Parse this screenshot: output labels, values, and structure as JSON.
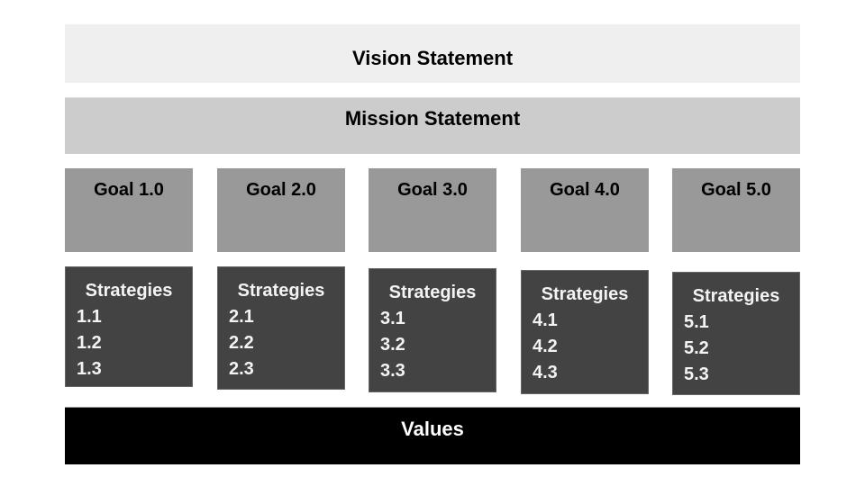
{
  "vision": "Vision Statement",
  "mission": "Mission Statement",
  "values": "Values",
  "goals": [
    {
      "label": "Goal 1.0",
      "strategies_title": "Strategies",
      "strategies": [
        "1.1",
        "1.2",
        "1.3"
      ]
    },
    {
      "label": "Goal 2.0",
      "strategies_title": "Strategies",
      "strategies": [
        "2.1",
        "2.2",
        "2.3"
      ]
    },
    {
      "label": "Goal 3.0",
      "strategies_title": "Strategies",
      "strategies": [
        "3.1",
        "3.2",
        "3.3"
      ]
    },
    {
      "label": "Goal 4.0",
      "strategies_title": "Strategies",
      "strategies": [
        "4.1",
        "4.2",
        "4.3"
      ]
    },
    {
      "label": "Goal 5.0",
      "strategies_title": "Strategies",
      "strategies": [
        "5.1",
        "5.2",
        "5.3"
      ]
    }
  ],
  "colors": {
    "vision_bg": "#efefef",
    "mission_bg": "#cccccc",
    "goal_bg": "#999999",
    "strategy_bg": "#434343",
    "values_bg": "#000000"
  }
}
